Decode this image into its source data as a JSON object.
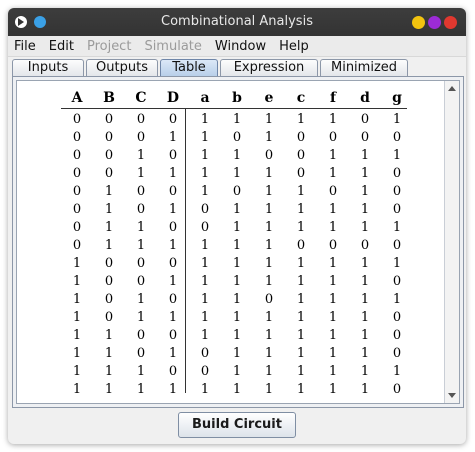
{
  "window": {
    "title": "Combinational Analysis"
  },
  "menu": [
    "File",
    "Edit",
    "Project",
    "Simulate",
    "Window",
    "Help"
  ],
  "menu_disabled": [
    false,
    false,
    true,
    true,
    false,
    false
  ],
  "tabs": [
    "Inputs",
    "Outputs",
    "Table",
    "Expression",
    "Minimized"
  ],
  "active_tab": "Table",
  "table": {
    "inputs": [
      "A",
      "B",
      "C",
      "D"
    ],
    "outputs": [
      "a",
      "b",
      "e",
      "c",
      "f",
      "d",
      "g"
    ],
    "rows": [
      [
        "0",
        "0",
        "0",
        "0",
        "1",
        "1",
        "1",
        "1",
        "1",
        "0",
        "1"
      ],
      [
        "0",
        "0",
        "0",
        "1",
        "1",
        "0",
        "1",
        "0",
        "0",
        "0",
        "0"
      ],
      [
        "0",
        "0",
        "1",
        "0",
        "1",
        "1",
        "0",
        "0",
        "1",
        "1",
        "1"
      ],
      [
        "0",
        "0",
        "1",
        "1",
        "1",
        "1",
        "1",
        "0",
        "1",
        "1",
        "0"
      ],
      [
        "0",
        "1",
        "0",
        "0",
        "1",
        "0",
        "1",
        "1",
        "0",
        "1",
        "0"
      ],
      [
        "0",
        "1",
        "0",
        "1",
        "0",
        "1",
        "1",
        "1",
        "1",
        "1",
        "0"
      ],
      [
        "0",
        "1",
        "1",
        "0",
        "0",
        "1",
        "1",
        "1",
        "1",
        "1",
        "1"
      ],
      [
        "0",
        "1",
        "1",
        "1",
        "1",
        "1",
        "1",
        "0",
        "0",
        "0",
        "0"
      ],
      [
        "1",
        "0",
        "0",
        "0",
        "1",
        "1",
        "1",
        "1",
        "1",
        "1",
        "1"
      ],
      [
        "1",
        "0",
        "0",
        "1",
        "1",
        "1",
        "1",
        "1",
        "1",
        "1",
        "0"
      ],
      [
        "1",
        "0",
        "1",
        "0",
        "1",
        "1",
        "0",
        "1",
        "1",
        "1",
        "1"
      ],
      [
        "1",
        "0",
        "1",
        "1",
        "1",
        "1",
        "1",
        "1",
        "1",
        "1",
        "0"
      ],
      [
        "1",
        "1",
        "0",
        "0",
        "1",
        "1",
        "1",
        "1",
        "1",
        "1",
        "0"
      ],
      [
        "1",
        "1",
        "0",
        "1",
        "0",
        "1",
        "1",
        "1",
        "1",
        "1",
        "0"
      ],
      [
        "1",
        "1",
        "1",
        "0",
        "0",
        "1",
        "1",
        "1",
        "1",
        "1",
        "1"
      ],
      [
        "1",
        "1",
        "1",
        "1",
        "1",
        "1",
        "1",
        "1",
        "1",
        "1",
        "0"
      ]
    ]
  },
  "build_button": "Build Circuit",
  "colors": {
    "close": "#e0382f",
    "maximize": "#9c2bd6",
    "minimize": "#f2c30f",
    "accent_tab": "#b8cfe9"
  },
  "icons": {
    "left": "logisim-icon",
    "blue": "app-dot-icon"
  }
}
